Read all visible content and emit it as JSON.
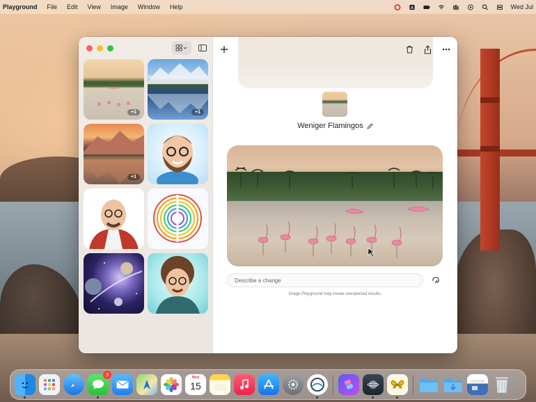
{
  "menubar": {
    "app_name": "Playground",
    "menus": [
      "File",
      "Edit",
      "View",
      "Image",
      "Window",
      "Help"
    ],
    "clock": "Wed Jul"
  },
  "sidebar": {
    "thumbnails": [
      {
        "subject": "flamingos",
        "badge": "+1"
      },
      {
        "subject": "mountain lake",
        "badge": "+1"
      },
      {
        "subject": "sunset lake",
        "badge": "+1"
      },
      {
        "subject": "bearded avatar",
        "badge": ""
      },
      {
        "subject": "scientist avatar",
        "badge": ""
      },
      {
        "subject": "rainbow brain",
        "badge": ""
      },
      {
        "subject": "space planets",
        "badge": ""
      },
      {
        "subject": "curly hair avatar",
        "badge": ""
      }
    ]
  },
  "main": {
    "title": "Weniger Flamingos",
    "prompt_placeholder": "Describe a change",
    "disclaimer": "Image Playground may create unexpected results."
  },
  "dock": {
    "calendar_day": "Wed",
    "calendar_date": "15",
    "messages_badge": "3"
  },
  "colors": {
    "accent": "#007aff",
    "traffic_red": "#ff5f57",
    "traffic_yellow": "#febc2e",
    "traffic_green": "#28c840"
  }
}
